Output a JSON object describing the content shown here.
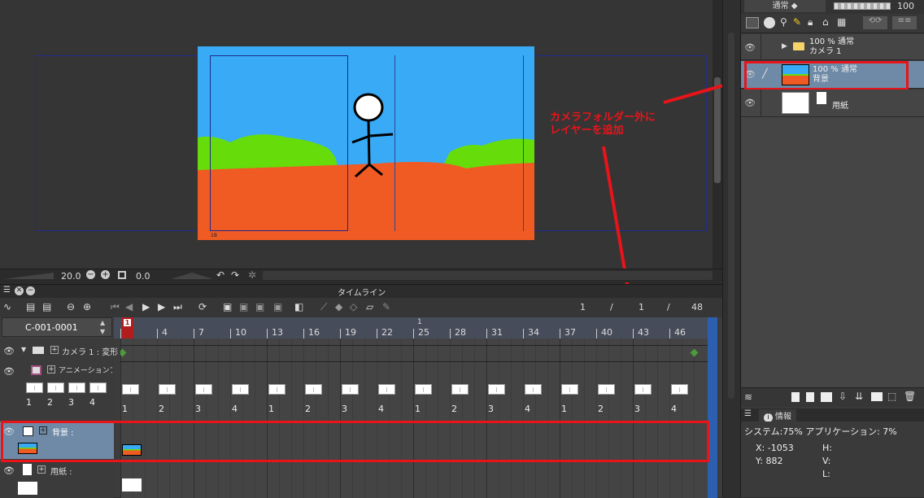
{
  "canvas": {
    "zoom": "20.0",
    "rotation": "0.0",
    "annotation_line1": "カメラフォルダー外に",
    "annotation_line2": "レイヤーを追加",
    "colors": {
      "sky": "#38aaf6",
      "ground": "#f05a23",
      "grass": "#66dd0a",
      "highlight": "#e8141a",
      "frame_line": "#2030a0"
    }
  },
  "layers_panel": {
    "blend_mode": "通常",
    "opacity": "100",
    "layers": [
      {
        "percent_mode": "100 % 通常",
        "name": "カメラ 1",
        "type": "folder"
      },
      {
        "percent_mode": "100 % 通常",
        "name": "背景",
        "type": "raster"
      },
      {
        "percent_mode": "",
        "name": "用紙",
        "type": "paper"
      }
    ]
  },
  "info_panel": {
    "tab_label": "情報",
    "cpu": "システム:75%  アプリケーション: 7%",
    "x_label": "X: -1053",
    "y_label": "Y: 882",
    "h_label": "H:",
    "v_label": "V:",
    "l_label": "L:"
  },
  "timeline": {
    "title": "タイムライン",
    "frame_current": "1",
    "slash1": "/",
    "frame_mid": "1",
    "slash2": "/",
    "frame_total": "48",
    "sequence_name": "C-001-0001",
    "ruler_top_label": "1",
    "ruler": [
      "1",
      "4",
      "7",
      "10",
      "13",
      "16",
      "19",
      "22",
      "25",
      "28",
      "31",
      "34",
      "37",
      "40",
      "43",
      "46"
    ],
    "tracks": [
      {
        "name": "カメラ 1 : 変形"
      },
      {
        "name": "アニメーションフ"
      },
      {
        "name": "背景 :"
      },
      {
        "name": "用紙 :"
      }
    ],
    "anim_left_nums": [
      "1",
      "2",
      "3",
      "4"
    ],
    "anim_cell_nums": [
      "1",
      "2",
      "3",
      "4",
      "1",
      "2",
      "3",
      "4",
      "1",
      "2",
      "3",
      "4",
      "1",
      "2",
      "3",
      "4"
    ]
  }
}
